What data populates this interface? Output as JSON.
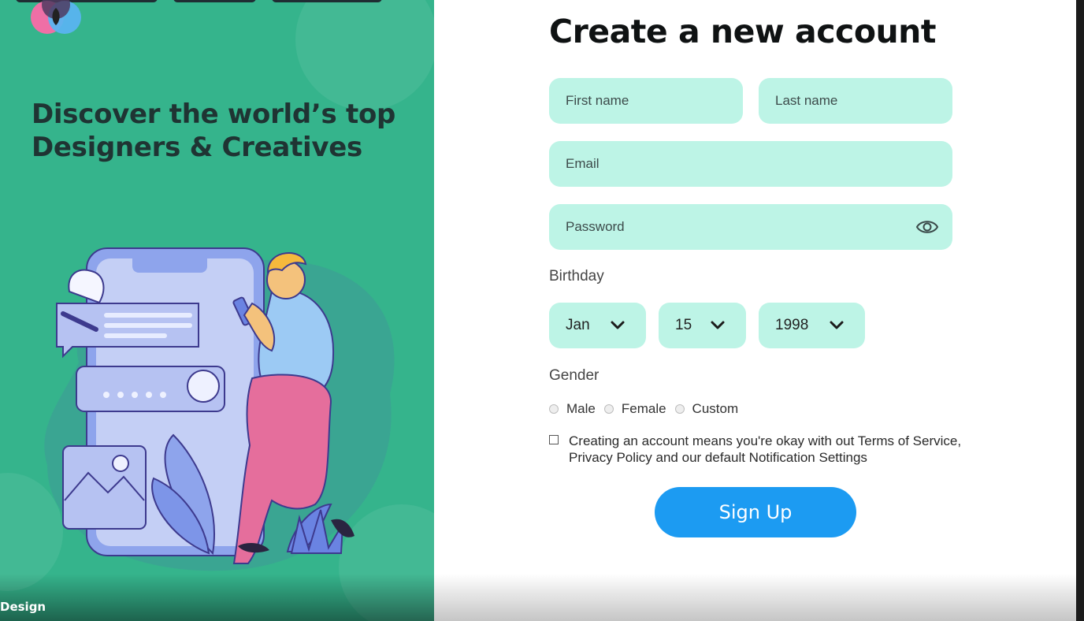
{
  "brand": {
    "footer_label": "Design"
  },
  "hero": {
    "headline": "Discover the world’s top Designers & Creatives"
  },
  "form": {
    "title": "Create a new account",
    "first_name_placeholder": "First name",
    "last_name_placeholder": "Last name",
    "email_placeholder": "Email",
    "password_placeholder": "Password",
    "birthday_label": "Birthday",
    "birthday": {
      "month": "Jan",
      "day": "15",
      "year": "1998"
    },
    "gender_label": "Gender",
    "gender_options": [
      "Male",
      "Female",
      "Custom"
    ],
    "terms_text": "Creating an account means you're okay with out Terms of Service, Privacy Policy and our default Notification Settings",
    "submit_label": "Sign Up"
  },
  "colors": {
    "left_panel": "#35b48c",
    "field_bg": "#bdf4e6",
    "primary_button": "#1c9bf2"
  },
  "icons": [
    "logo-icon",
    "eye-icon",
    "chevron-down-icon"
  ]
}
